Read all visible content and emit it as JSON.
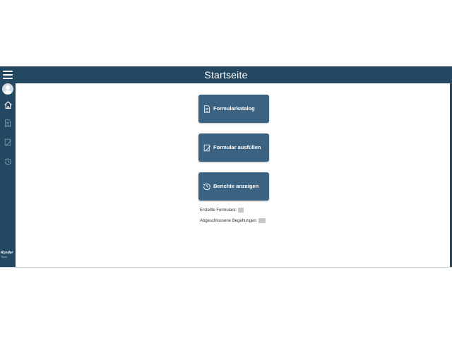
{
  "header": {
    "title": "Startseite",
    "menu_icon": "hamburger-icon"
  },
  "sidebar": {
    "items": [
      {
        "name": "home",
        "icon": "home-icon"
      },
      {
        "name": "catalog",
        "icon": "document-icon"
      },
      {
        "name": "fill",
        "icon": "edit-form-icon"
      },
      {
        "name": "history",
        "icon": "history-icon"
      }
    ],
    "logo_text": "Runder",
    "logo_sub": "Tisch"
  },
  "main": {
    "buttons": [
      {
        "label": "Formularkatalog",
        "icon": "document-icon"
      },
      {
        "label": "Formular ausfüllen",
        "icon": "edit-form-icon"
      },
      {
        "label": "Berichte anzeigen",
        "icon": "history-icon"
      }
    ],
    "stats": {
      "forms_label": "Erstellte Formulare:",
      "forms_value": "00",
      "visits_label": "Abgeschlossene Begehungen:",
      "visits_value": "000"
    }
  },
  "colors": {
    "primary": "#244862",
    "button": "#3b6381",
    "background": "#ffffff"
  }
}
